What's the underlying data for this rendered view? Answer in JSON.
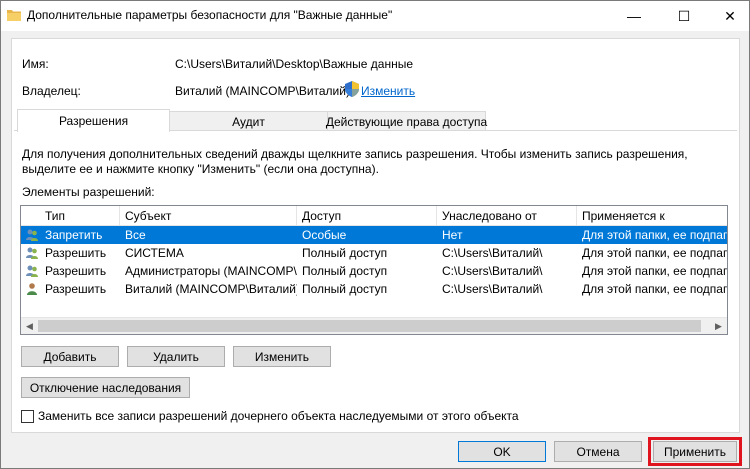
{
  "window": {
    "title": "Дополнительные параметры безопасности  для \"Важные данные\"",
    "minimize": "—",
    "maximize": "☐",
    "close": "✕"
  },
  "info": {
    "name_label": "Имя:",
    "name_value": "C:\\Users\\Виталий\\Desktop\\Важные данные",
    "owner_label": "Владелец:",
    "owner_value": "Виталий (MAINCOMP\\Виталий)",
    "change_link": "Изменить"
  },
  "tabs": [
    {
      "label": "Разрешения",
      "active": true
    },
    {
      "label": "Аудит",
      "active": false
    },
    {
      "label": "Действующие права доступа",
      "active": false
    }
  ],
  "panel": {
    "description": "Для получения дополнительных сведений дважды щелкните запись разрешения. Чтобы изменить запись разрешения, выделите ее и нажмите кнопку \"Изменить\" (если она доступна).",
    "entries_label": "Элементы разрешений:"
  },
  "grid": {
    "columns": [
      "Тип",
      "Субъект",
      "Доступ",
      "Унаследовано от",
      "Применяется к"
    ],
    "rows": [
      {
        "type": "Запретить",
        "subject": "Все",
        "access": "Особые",
        "inherited": "Нет",
        "applies": "Для этой папки, ее подпапок и файлов",
        "icon": "users-icon",
        "selected": true
      },
      {
        "type": "Разрешить",
        "subject": "СИСТЕМА",
        "access": "Полный доступ",
        "inherited": "C:\\Users\\Виталий\\",
        "applies": "Для этой папки, ее подпапок и файлов",
        "icon": "users-icon",
        "selected": false
      },
      {
        "type": "Разрешить",
        "subject": "Администраторы (MAINCOMP\\...",
        "access": "Полный доступ",
        "inherited": "C:\\Users\\Виталий\\",
        "applies": "Для этой папки, ее подпапок и файлов",
        "icon": "users-icon",
        "selected": false
      },
      {
        "type": "Разрешить",
        "subject": "Виталий (MAINCOMP\\Виталий)",
        "access": "Полный доступ",
        "inherited": "C:\\Users\\Виталий\\",
        "applies": "Для этой папки, ее подпапок и файлов",
        "icon": "user-icon",
        "selected": false
      }
    ]
  },
  "buttons": {
    "add": "Добавить",
    "remove": "Удалить",
    "edit": "Изменить",
    "disable_inheritance": "Отключение наследования",
    "ok": "OK",
    "cancel": "Отмена",
    "apply": "Применить"
  },
  "checkbox": {
    "label": "Заменить все записи разрешений дочернего объекта наследуемыми от этого объекта",
    "checked": false
  },
  "colors": {
    "selection": "#0078d7",
    "link": "#0066cc",
    "highlight": "#e0141e"
  }
}
